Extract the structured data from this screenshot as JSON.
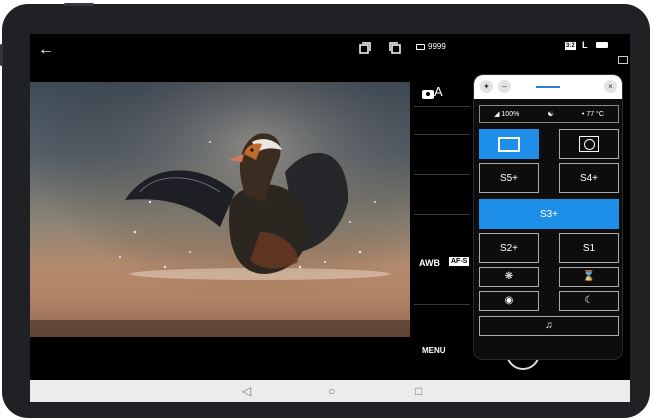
{
  "topbar": {
    "back_icon": "arrow-left-icon",
    "shots_remaining": "9999",
    "aspect_ratio": "3:2",
    "image_size": "L"
  },
  "camera": {
    "mode_sub": "A",
    "white_balance": "AWB",
    "focus_mode": "AF-S",
    "menu_label": "MENU"
  },
  "panel": {
    "battery_level": "100%",
    "temperature": "77 °C",
    "buttons": [
      {
        "label": "",
        "icon": "square-frame-icon",
        "active": true
      },
      {
        "label": "",
        "icon": "circle-frame-icon",
        "active": false
      },
      {
        "label": "S5+",
        "active": false
      },
      {
        "label": "S4+",
        "active": false
      },
      {
        "label": "S3+",
        "active": true
      },
      {
        "label": "S2+",
        "active": false
      },
      {
        "label": "S1",
        "active": false
      }
    ],
    "icon_buttons": [
      "fan-icon",
      "hourglass-icon",
      "camera-timer-icon",
      "moon-icon",
      "music-icon"
    ]
  },
  "navbar": {
    "back": "◁",
    "home": "○",
    "recents": "□"
  },
  "colors": {
    "accent": "#1e8fe8",
    "background": "#000000",
    "frame": "#202124"
  }
}
